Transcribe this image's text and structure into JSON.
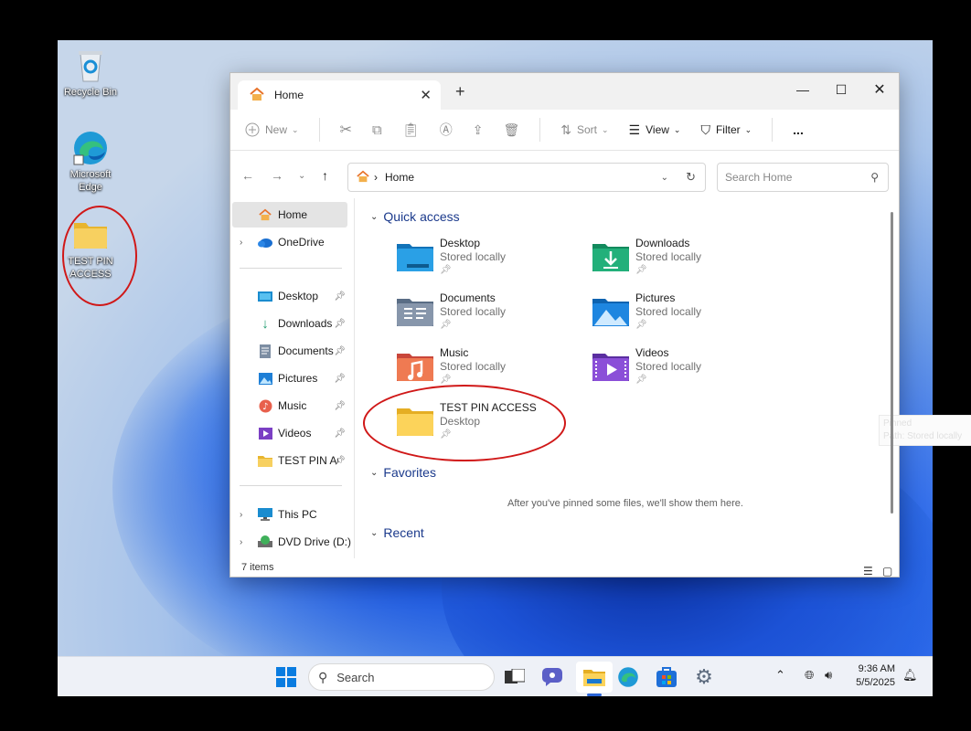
{
  "desktop": {
    "icons": [
      {
        "label": "Recycle Bin",
        "icon": "recycle-bin-icon"
      },
      {
        "label": "Microsoft Edge",
        "icon": "edge-icon"
      },
      {
        "label": "TEST PIN ACCESS",
        "icon": "folder-icon"
      }
    ]
  },
  "explorer": {
    "tab_title": "Home",
    "new_tab_symbol": "+",
    "toolbar": {
      "new": "New",
      "sort": "Sort",
      "view": "View",
      "filter": "Filter",
      "more": "..."
    },
    "address": {
      "path": "Home"
    },
    "search": {
      "placeholder": "Search Home"
    },
    "sidebar": {
      "home": "Home",
      "onedrive": "OneDrive",
      "pinned": [
        {
          "label": "Desktop",
          "icon": "desktop-icon"
        },
        {
          "label": "Downloads",
          "icon": "download-icon"
        },
        {
          "label": "Documents",
          "icon": "documents-icon"
        },
        {
          "label": "Pictures",
          "icon": "pictures-icon"
        },
        {
          "label": "Music",
          "icon": "music-icon"
        },
        {
          "label": "Videos",
          "icon": "videos-icon"
        },
        {
          "label": "TEST PIN ACCESS",
          "icon": "folder-icon"
        }
      ],
      "this_pc": "This PC",
      "dvd": "DVD Drive (D:) C"
    },
    "sections": {
      "quick_access": "Quick access",
      "favorites": "Favorites",
      "recent": "Recent",
      "favorites_empty": "After you've pinned some files, we'll show them here."
    },
    "quick_access": [
      {
        "name": "Desktop",
        "sub": "Stored locally",
        "icon": "desktop-folder-icon"
      },
      {
        "name": "Downloads",
        "sub": "Stored locally",
        "icon": "downloads-folder-icon"
      },
      {
        "name": "Documents",
        "sub": "Stored locally",
        "icon": "documents-folder-icon"
      },
      {
        "name": "Pictures",
        "sub": "Stored locally",
        "icon": "pictures-folder-icon"
      },
      {
        "name": "Music",
        "sub": "Stored locally",
        "icon": "music-folder-icon"
      },
      {
        "name": "Videos",
        "sub": "Stored locally",
        "icon": "videos-folder-icon"
      },
      {
        "name": "TEST PIN ACCESS",
        "sub": "Desktop",
        "icon": "folder-icon"
      }
    ],
    "tooltip_ghost": {
      "line1": "Pinned",
      "line2": "Path: Stored locally"
    },
    "status": {
      "items": "7 items"
    }
  },
  "taskbar": {
    "search_label": "Search",
    "time": "9:36 AM",
    "date": "5/5/2025"
  },
  "colors": {
    "annotation_circle": "#d01818",
    "folder_yellow": "#f7c948",
    "accent": "#2a64d6"
  }
}
